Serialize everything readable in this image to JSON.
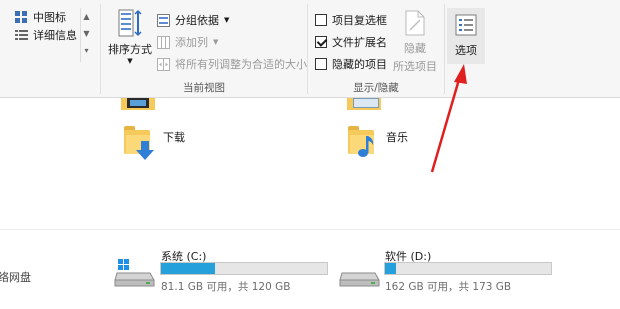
{
  "layout_group": {
    "medium_icons": "中图标",
    "details": "详细信息"
  },
  "current_view": {
    "sort_by": "排序方式",
    "group_by": "分组依据",
    "add_columns": "添加列",
    "size_all_columns": "将所有列调整为合适的大小",
    "group_label": "当前视图"
  },
  "show_hide": {
    "item_checkboxes": "项目复选框",
    "file_extensions": "文件扩展名",
    "hidden_items": "隐藏的项目",
    "hide_selected_line1": "隐藏",
    "hide_selected_line2": "所选项目",
    "group_label": "显示/隐藏",
    "checkbox_states": {
      "item_checkboxes": false,
      "file_extensions": true,
      "hidden_items": false
    }
  },
  "options": {
    "label": "选项"
  },
  "folders": {
    "downloads": "下载",
    "music": "音乐"
  },
  "network_partial": "络网盘",
  "drives": [
    {
      "name": "系统 (C:)",
      "free_text": "81.1 GB 可用，共 120 GB",
      "used_fraction": 0.324
    },
    {
      "name": "软件 (D:)",
      "free_text": "162 GB 可用，共 173 GB",
      "used_fraction": 0.064
    }
  ],
  "colors": {
    "accent": "#26a0da",
    "annotation_arrow": "#e02020"
  }
}
